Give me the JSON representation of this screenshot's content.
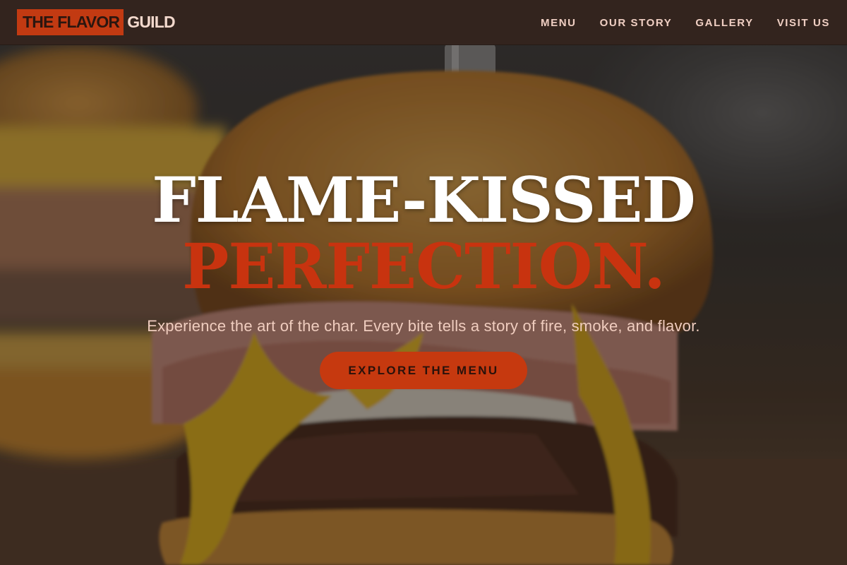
{
  "brand": {
    "mark": "THE FLAVOR",
    "word": "GUILD",
    "accent_color": "#c23a12"
  },
  "nav": {
    "items": [
      "MENU",
      "OUR STORY",
      "GALLERY",
      "VISIT US"
    ]
  },
  "hero": {
    "background": "burger-photo",
    "headline_line1": "FLAME-KISSED",
    "headline_line2": "PERFECTION.",
    "subtext": "Experience the art of the char. Every bite tells a story of fire, smoke, and flavor.",
    "cta_label": "EXPLORE THE MENU"
  }
}
